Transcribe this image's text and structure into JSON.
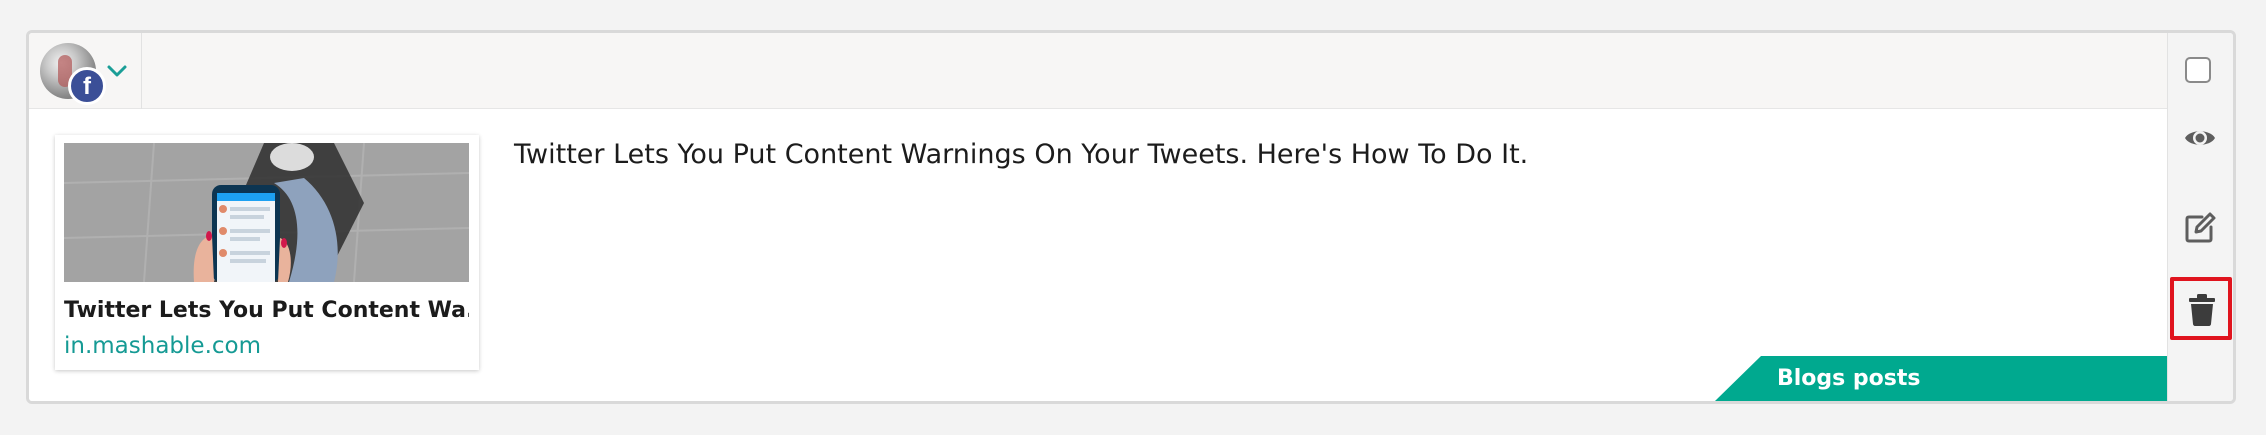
{
  "account": {
    "network": "facebook",
    "badge_letter": "f",
    "icons": {
      "avatar": "profile-avatar",
      "badge": "facebook-icon",
      "dropdown": "chevron-down-icon"
    }
  },
  "post": {
    "text": "Twitter Lets You Put Content Warnings On Your Tweets. Here's How To Do It.",
    "link_preview": {
      "title": "Twitter Lets You Put Content Wa...",
      "domain": "in.mashable.com"
    },
    "category_label": "Blogs posts"
  },
  "actions": {
    "select": "checkbox",
    "preview": "eye-icon",
    "edit": "edit-icon",
    "delete": "trash-icon"
  },
  "colors": {
    "accent": "#00a98f",
    "link": "#159a94",
    "facebook": "#3b4f97",
    "highlight": "#e0141e"
  }
}
